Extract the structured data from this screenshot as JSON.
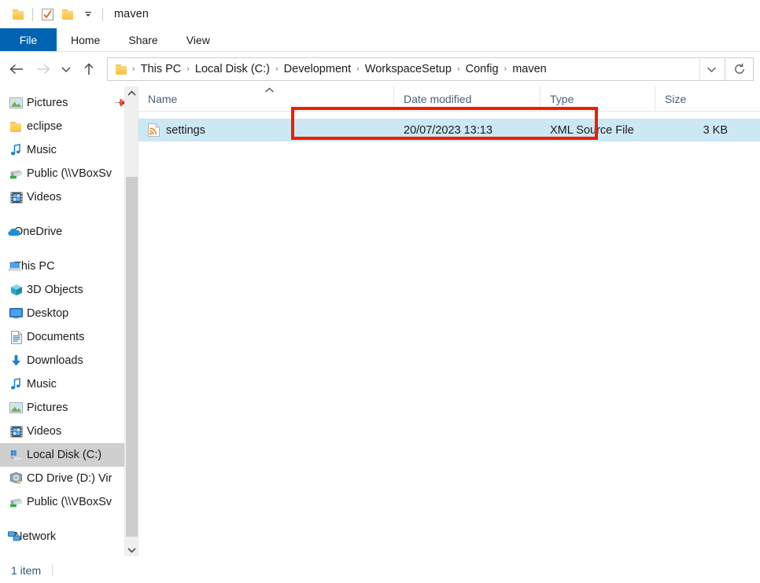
{
  "window": {
    "title": "maven",
    "quick_access": [
      {
        "name": "folder-icon",
        "label": "Folder"
      },
      {
        "name": "properties-icon",
        "label": "Properties"
      },
      {
        "name": "new-folder-icon",
        "label": "New folder"
      },
      {
        "name": "customize-dropdown-icon",
        "label": "Customize Quick Access Toolbar"
      }
    ]
  },
  "ribbon": {
    "tabs": [
      {
        "label": "File",
        "active": true
      },
      {
        "label": "Home",
        "active": false
      },
      {
        "label": "Share",
        "active": false
      },
      {
        "label": "View",
        "active": false
      }
    ],
    "active_tab_color": "#0063b1"
  },
  "addressbar": {
    "back_label": "Back",
    "forward_label": "Forward",
    "recent_label": "Recent locations",
    "up_label": "Up",
    "crumbs": [
      {
        "label": "This PC",
        "highlighted": false
      },
      {
        "label": "Local Disk (C:)",
        "highlighted": false
      },
      {
        "label": "Development",
        "highlighted": true
      },
      {
        "label": "WorkspaceSetup",
        "highlighted": true
      },
      {
        "label": "Config",
        "highlighted": true
      },
      {
        "label": "maven",
        "highlighted": true
      }
    ],
    "separator": "›",
    "dropdown_label": "Previous locations",
    "refresh_label": "Refresh",
    "highlight_color": "#f11c00"
  },
  "sidebar": {
    "selected": "Local Disk (C:)",
    "selection_color": "#cfcfcf",
    "items": [
      {
        "label": "Pictures",
        "icon": "pictures-icon",
        "level": 1,
        "pinned": true
      },
      {
        "label": "eclipse",
        "icon": "folder-icon",
        "level": 1
      },
      {
        "label": "Music",
        "icon": "music-icon",
        "level": 1
      },
      {
        "label": "Public (\\\\VBoxSv",
        "icon": "network-drive-icon",
        "level": 1
      },
      {
        "label": "Videos",
        "icon": "videos-icon",
        "level": 1
      },
      {
        "label": "",
        "icon": "spacer",
        "level": 0,
        "spacer": true
      },
      {
        "label": "OneDrive",
        "icon": "onedrive-icon",
        "level": 0
      },
      {
        "label": "",
        "icon": "spacer",
        "level": 0,
        "spacer": true
      },
      {
        "label": "This PC",
        "icon": "this-pc-icon",
        "level": 0
      },
      {
        "label": "3D Objects",
        "icon": "3d-objects-icon",
        "level": 1
      },
      {
        "label": "Desktop",
        "icon": "desktop-icon",
        "level": 1
      },
      {
        "label": "Documents",
        "icon": "documents-icon",
        "level": 1
      },
      {
        "label": "Downloads",
        "icon": "downloads-icon",
        "level": 1
      },
      {
        "label": "Music",
        "icon": "music-icon",
        "level": 1
      },
      {
        "label": "Pictures",
        "icon": "pictures-icon",
        "level": 1
      },
      {
        "label": "Videos",
        "icon": "videos-icon",
        "level": 1
      },
      {
        "label": "Local Disk (C:)",
        "icon": "local-disk-icon",
        "level": 1,
        "selected": true
      },
      {
        "label": "CD Drive (D:) Vir",
        "icon": "cd-drive-icon",
        "level": 1
      },
      {
        "label": "Public (\\\\VBoxSv",
        "icon": "network-drive-icon",
        "level": 1
      },
      {
        "label": "",
        "icon": "spacer",
        "level": 0,
        "spacer": true
      },
      {
        "label": "Network",
        "icon": "network-icon",
        "level": 0
      }
    ]
  },
  "filelist": {
    "columns": [
      {
        "key": "name",
        "label": "Name",
        "sorted": true,
        "sort_dir": "asc"
      },
      {
        "key": "date",
        "label": "Date modified",
        "sorted": false
      },
      {
        "key": "type",
        "label": "Type",
        "sorted": false
      },
      {
        "key": "size",
        "label": "Size",
        "sorted": false
      }
    ],
    "sort_caret": "︿",
    "rows": [
      {
        "name": "settings",
        "date": "20/07/2023 13:13",
        "type": "XML Source File",
        "size": "3 KB",
        "icon": "xml-file-icon",
        "selected": true
      }
    ],
    "selection_color": "#cce8f4"
  },
  "statusbar": {
    "item_count": "1 item"
  }
}
